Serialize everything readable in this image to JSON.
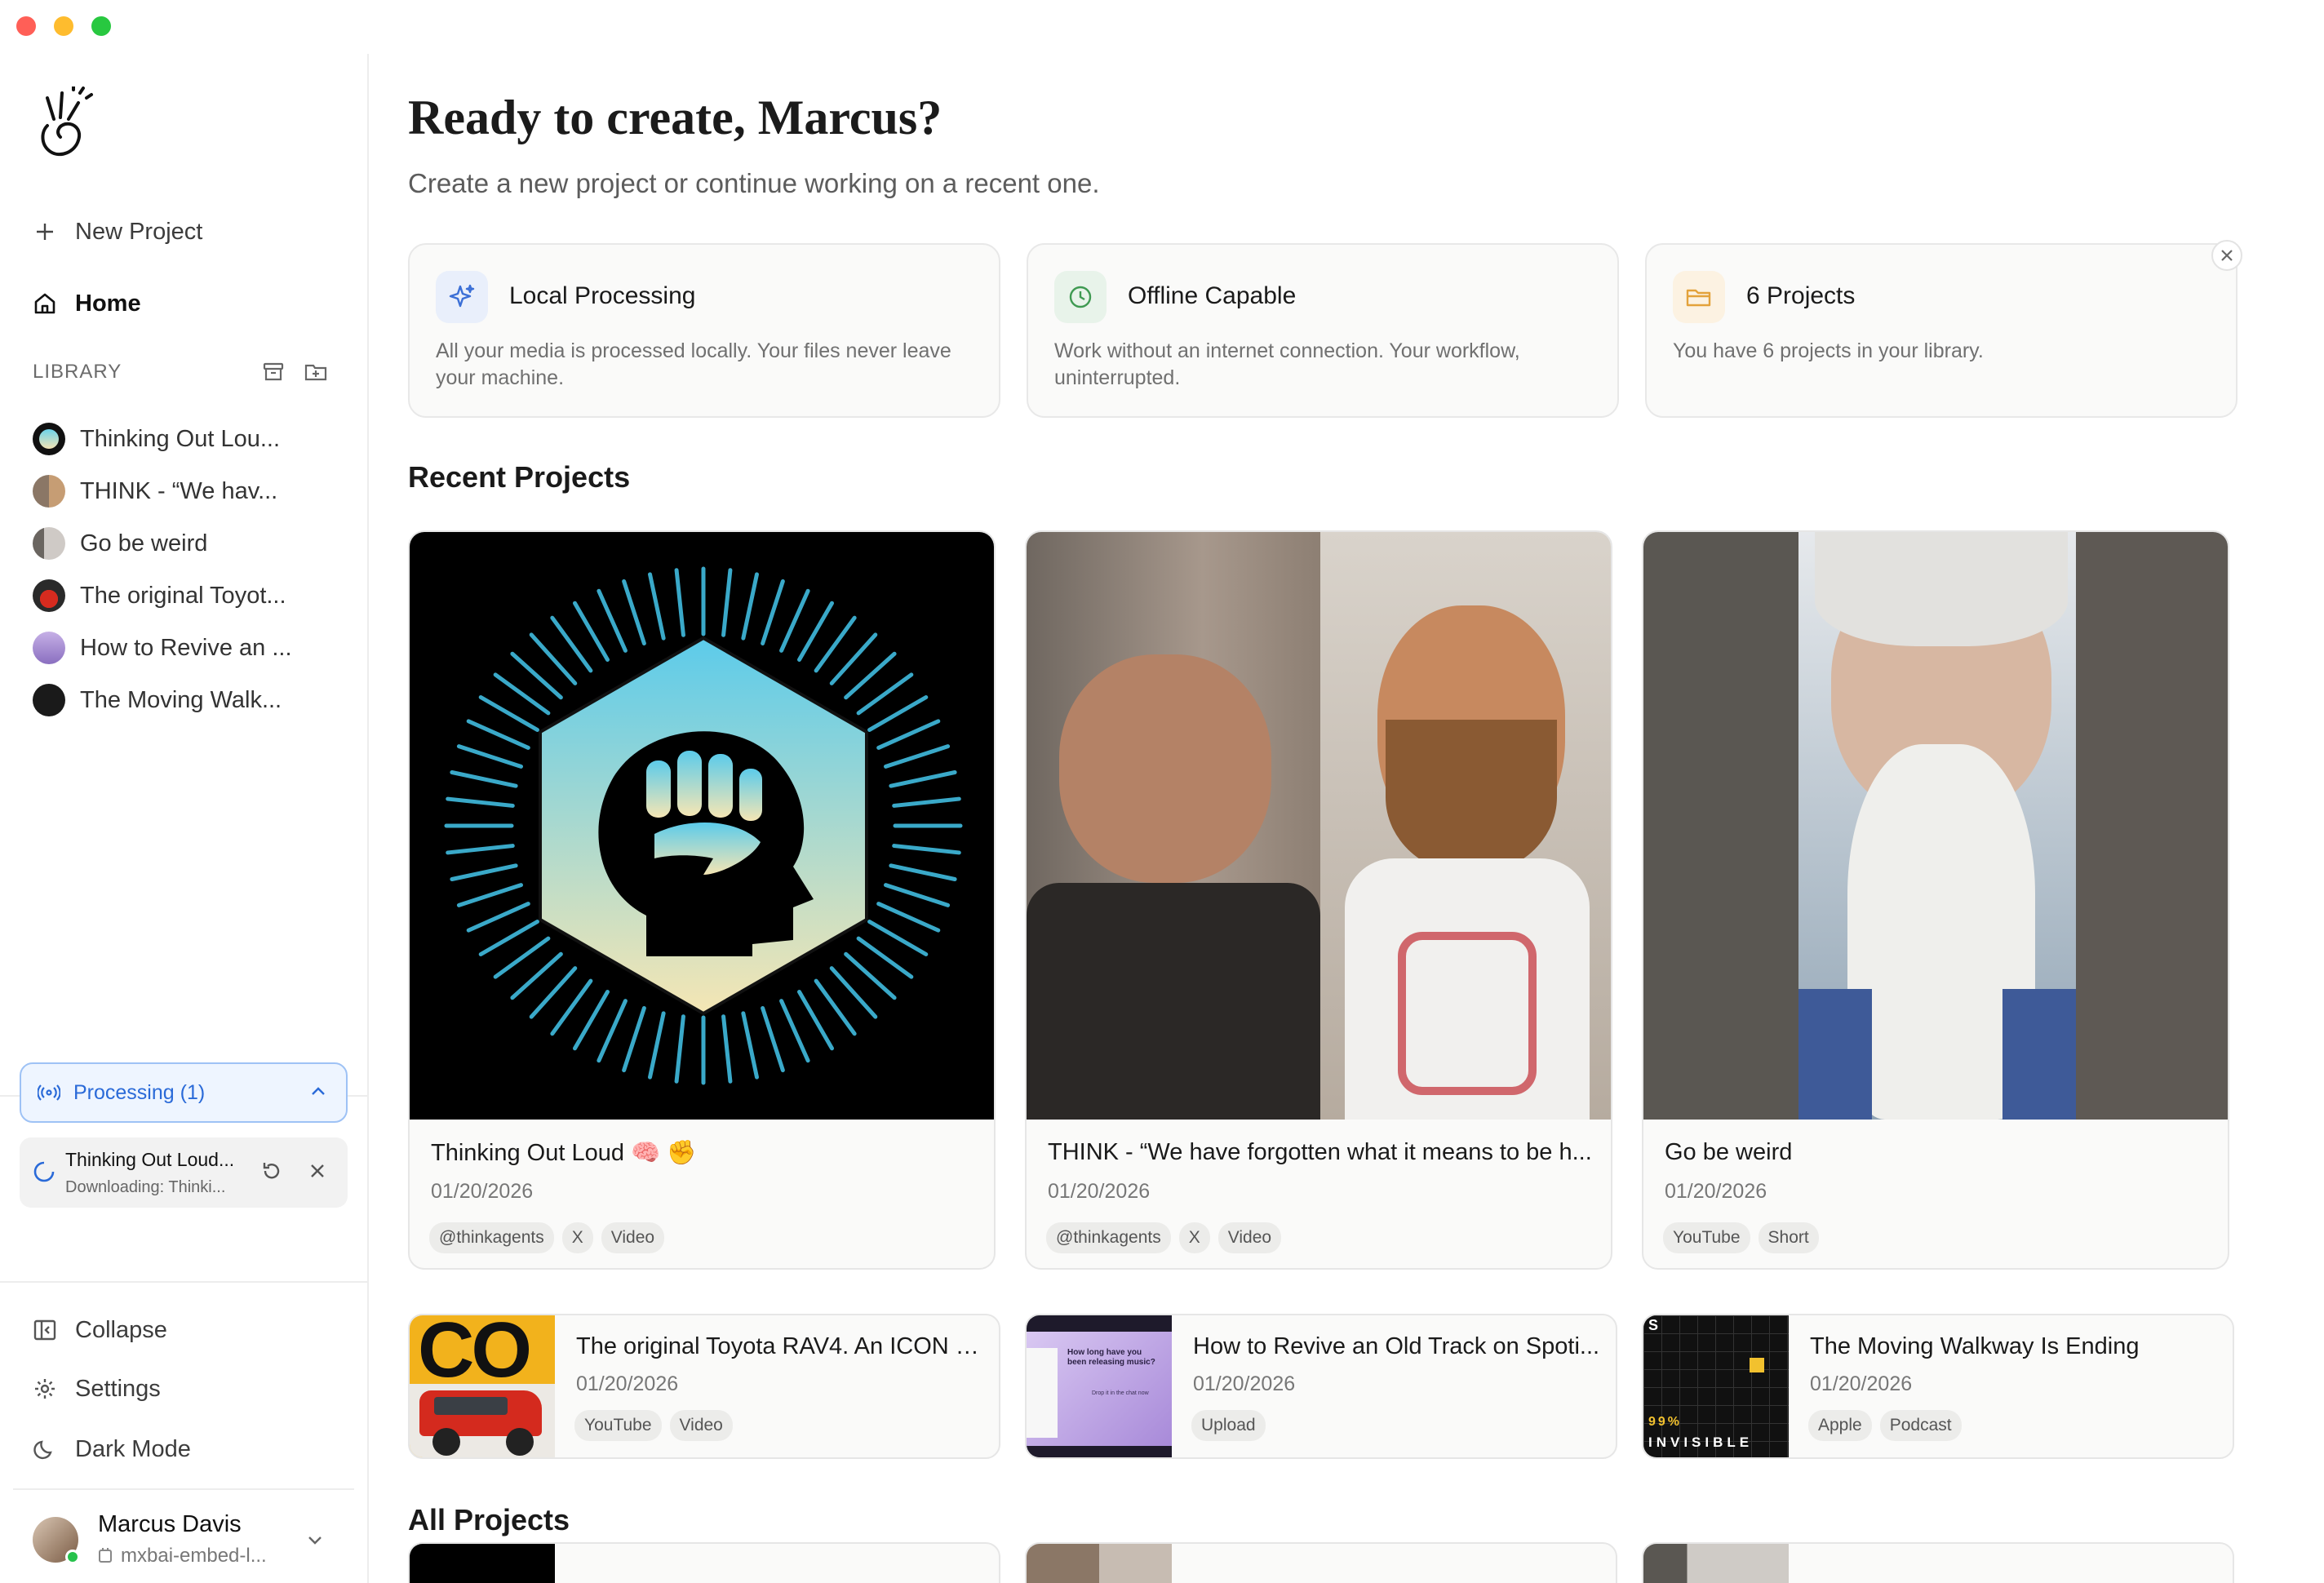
{
  "window": {
    "title": ""
  },
  "sidebar": {
    "new_project_label": "New Project",
    "home_label": "Home",
    "library_label": "LIBRARY",
    "library_items": [
      {
        "label": "Thinking Out Lou..."
      },
      {
        "label": "THINK - “We hav..."
      },
      {
        "label": "Go be weird"
      },
      {
        "label": "The original Toyot..."
      },
      {
        "label": "How to Revive an ..."
      },
      {
        "label": "The Moving Walk..."
      }
    ],
    "processing_label": "Processing (1)",
    "processing_item": {
      "title": "Thinking Out Loud...",
      "status": "Downloading: Thinki..."
    },
    "collapse_label": "Collapse",
    "settings_label": "Settings",
    "dark_mode_label": "Dark Mode",
    "user": {
      "name": "Marcus Davis",
      "model": "mxbai-embed-l..."
    }
  },
  "main": {
    "greeting": "Ready to create, Marcus?",
    "subtitle": "Create a new project or continue working on a recent one.",
    "info_cards": [
      {
        "title": "Local Processing",
        "desc": "All your media is processed locally. Your files never leave your machine.",
        "icon": "sparkle-icon",
        "accent": "#3b6fd6"
      },
      {
        "title": "Offline Capable",
        "desc": "Work without an internet connection. Your workflow, uninterrupted.",
        "icon": "clock-icon",
        "accent": "#3f9a52"
      },
      {
        "title": "6 Projects",
        "desc": "You have 6 projects in your library.",
        "icon": "folder-icon",
        "accent": "#e3a23b"
      }
    ],
    "recent_title": "Recent Projects",
    "recent_projects": [
      {
        "title": "Thinking Out Loud 🧠 ✊",
        "date": "01/20/2026",
        "tags": [
          "@thinkagents",
          "X",
          "Video"
        ]
      },
      {
        "title": "THINK - “We have forgotten what it means to be h...",
        "date": "01/20/2026",
        "tags": [
          "@thinkagents",
          "X",
          "Video"
        ]
      },
      {
        "title": "Go be weird",
        "date": "01/20/2026",
        "tags": [
          "YouTube",
          "Short"
        ]
      }
    ],
    "more_projects": [
      {
        "title": "The original Toyota RAV4. An ICON y...",
        "date": "01/20/2026",
        "tags": [
          "YouTube",
          "Video"
        ]
      },
      {
        "title": "How to Revive an Old Track on Spoti...",
        "date": "01/20/2026",
        "tags": [
          "Upload"
        ]
      },
      {
        "title": "The Moving Walkway Is Ending",
        "date": "01/20/2026",
        "tags": [
          "Apple",
          "Podcast"
        ]
      }
    ],
    "all_title": "All Projects",
    "thumb_texts": {
      "rav4": "CO",
      "revive": "How long have you been releasing music?",
      "revive_small": "Drop it in the chat now",
      "invisible_top": "99%",
      "invisible_bottom": "INVISIBLE",
      "invisible_s": "S"
    }
  }
}
